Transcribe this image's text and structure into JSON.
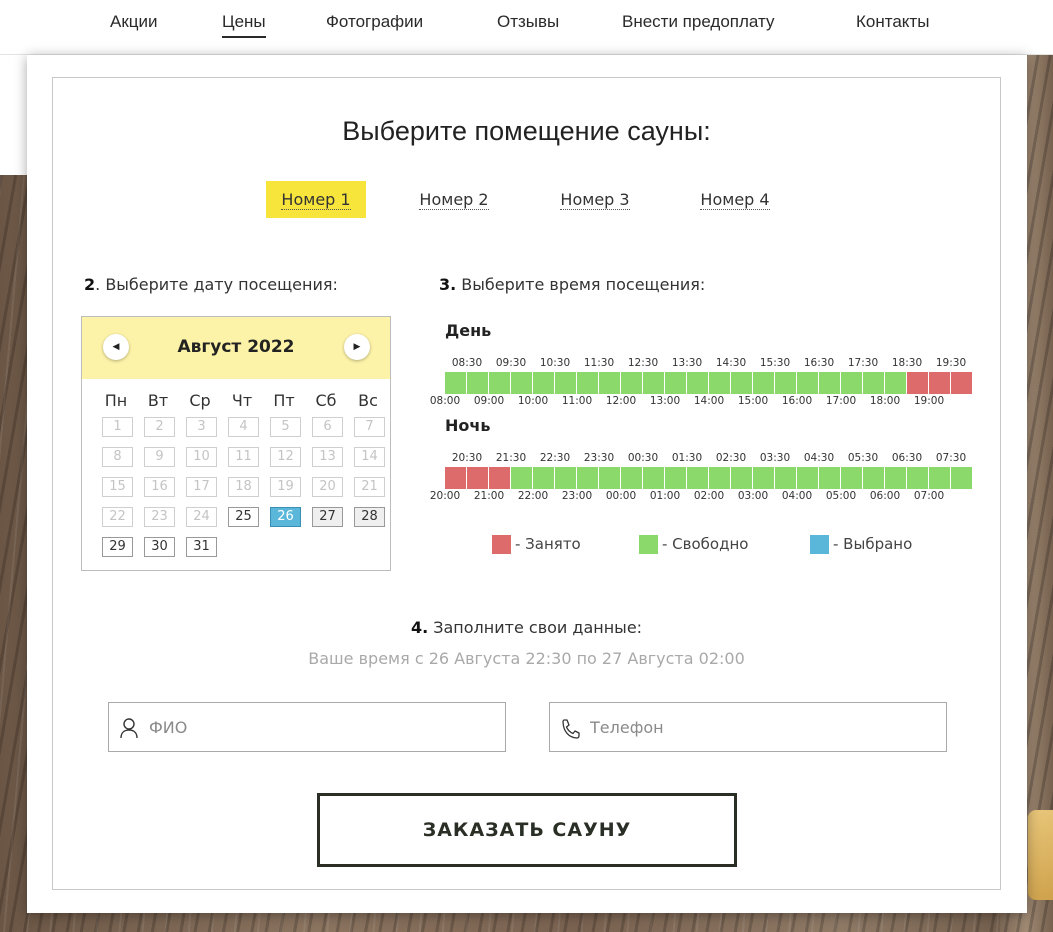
{
  "nav": {
    "items": [
      "Акции",
      "Цены",
      "Фотографии",
      "Отзывы",
      "Внести предоплату",
      "Контакты"
    ],
    "active": "Цены"
  },
  "title": "Выберите помещение сауны:",
  "rooms": [
    "Номер 1",
    "Номер 2",
    "Номер 3",
    "Номер 4"
  ],
  "selected_room": "Номер 1",
  "date_section": {
    "num": "2",
    "text": ". Выберите дату посещения:"
  },
  "time_section": {
    "num": "3.",
    "text": " Выберите время посещения:"
  },
  "calendar": {
    "month": "Август 2022",
    "prev_icon": "arrow-left-icon",
    "next_icon": "arrow-right-icon",
    "weekdays": [
      "Пн",
      "Вт",
      "Ср",
      "Чт",
      "Пт",
      "Сб",
      "Вс"
    ],
    "days": [
      "1",
      "2",
      "3",
      "4",
      "5",
      "6",
      "7",
      "8",
      "9",
      "10",
      "11",
      "12",
      "13",
      "14",
      "15",
      "16",
      "17",
      "18",
      "19",
      "20",
      "21",
      "22",
      "23",
      "24",
      "25",
      "26",
      "27",
      "28",
      "29",
      "30",
      "31"
    ],
    "first_available": 25,
    "selected_day": 26,
    "weekend_available": [
      27,
      28
    ]
  },
  "day": {
    "title": "День",
    "top_labels": [
      "08:30",
      "09:30",
      "10:30",
      "11:30",
      "12:30",
      "13:30",
      "14:30",
      "15:30",
      "16:30",
      "17:30",
      "18:30",
      "19:30"
    ],
    "bottom_labels": [
      "08:00",
      "09:00",
      "10:00",
      "11:00",
      "12:00",
      "13:00",
      "14:00",
      "15:00",
      "16:00",
      "17:00",
      "18:00",
      "19:00"
    ],
    "slots": [
      "free",
      "free",
      "free",
      "free",
      "free",
      "free",
      "free",
      "free",
      "free",
      "free",
      "free",
      "free",
      "free",
      "free",
      "free",
      "free",
      "free",
      "free",
      "free",
      "free",
      "free",
      "busy",
      "busy",
      "busy"
    ]
  },
  "night": {
    "title": "Ночь",
    "top_labels": [
      "20:30",
      "21:30",
      "22:30",
      "23:30",
      "00:30",
      "01:30",
      "02:30",
      "03:30",
      "04:30",
      "05:30",
      "06:30",
      "07:30"
    ],
    "bottom_labels": [
      "20:00",
      "21:00",
      "22:00",
      "23:00",
      "00:00",
      "01:00",
      "02:00",
      "03:00",
      "04:00",
      "05:00",
      "06:00",
      "07:00"
    ],
    "slots": [
      "busy",
      "busy",
      "busy",
      "free",
      "free",
      "free",
      "free",
      "free",
      "free",
      "free",
      "free",
      "free",
      "free",
      "free",
      "free",
      "free",
      "free",
      "free",
      "free",
      "free",
      "free",
      "free",
      "free",
      "free"
    ]
  },
  "legend": [
    {
      "label": "- Занято",
      "color": "#de6b6b"
    },
    {
      "label": "- Свободно",
      "color": "#8ad96a"
    },
    {
      "label": "- Выбрано",
      "color": "#5bb7d9"
    }
  ],
  "form": {
    "num": "4.",
    "heading": " Заполните свои данные:",
    "summary": "Ваше время с 26 Августа 22:30 по 27 Августа 02:00",
    "name_placeholder": "ФИО",
    "name_icon": "user-icon",
    "phone_placeholder": "Телефон",
    "phone_icon": "phone-icon",
    "submit": "ЗАКАЗАТЬ САУНУ"
  }
}
